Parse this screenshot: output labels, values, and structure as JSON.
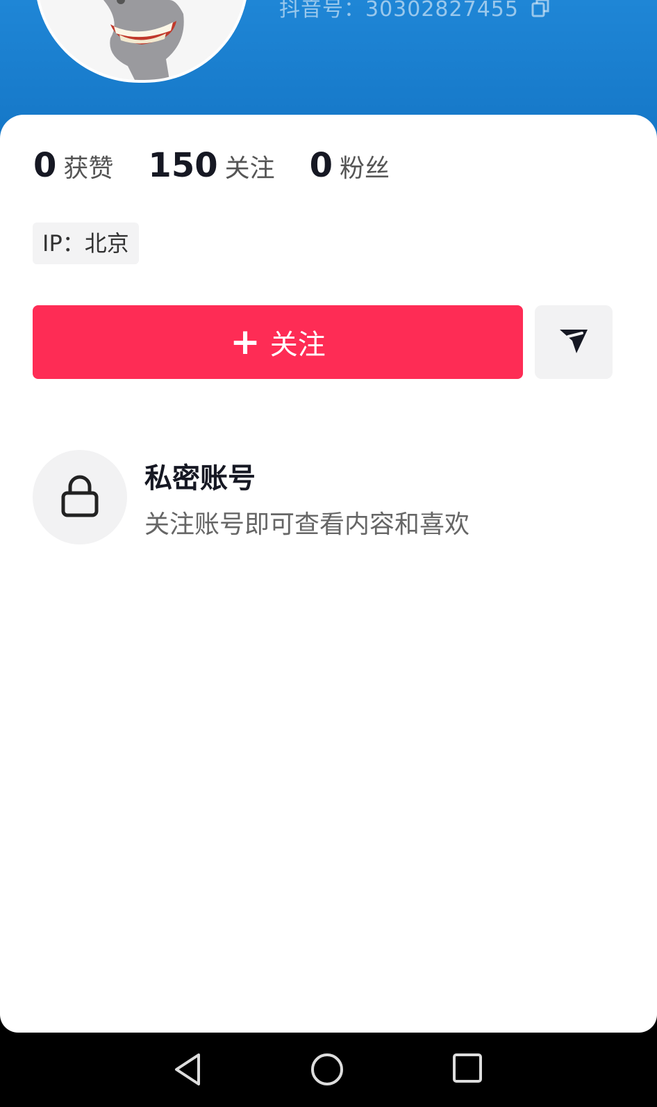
{
  "profile": {
    "douyin_id": "抖音号：30302827455"
  },
  "stats": [
    {
      "num": "0",
      "label": "获赞"
    },
    {
      "num": "150",
      "label": "关注"
    },
    {
      "num": "0",
      "label": "粉丝"
    }
  ],
  "ip_tag": "IP：北京",
  "actions": {
    "follow_plus": "+",
    "follow_label": "关注"
  },
  "private": {
    "title": "私密账号",
    "description": "关注账号即可查看内容和喜欢"
  },
  "colors": {
    "header_blue": "#1577c7",
    "follow_red": "#fe2c55",
    "text_dark": "#161823"
  },
  "icons": {
    "share": "send-icon",
    "lock": "lock-icon",
    "copy": "copy-icon",
    "nav_back": "back-triangle-icon",
    "nav_home": "home-circle-icon",
    "nav_recents": "recents-square-icon"
  }
}
